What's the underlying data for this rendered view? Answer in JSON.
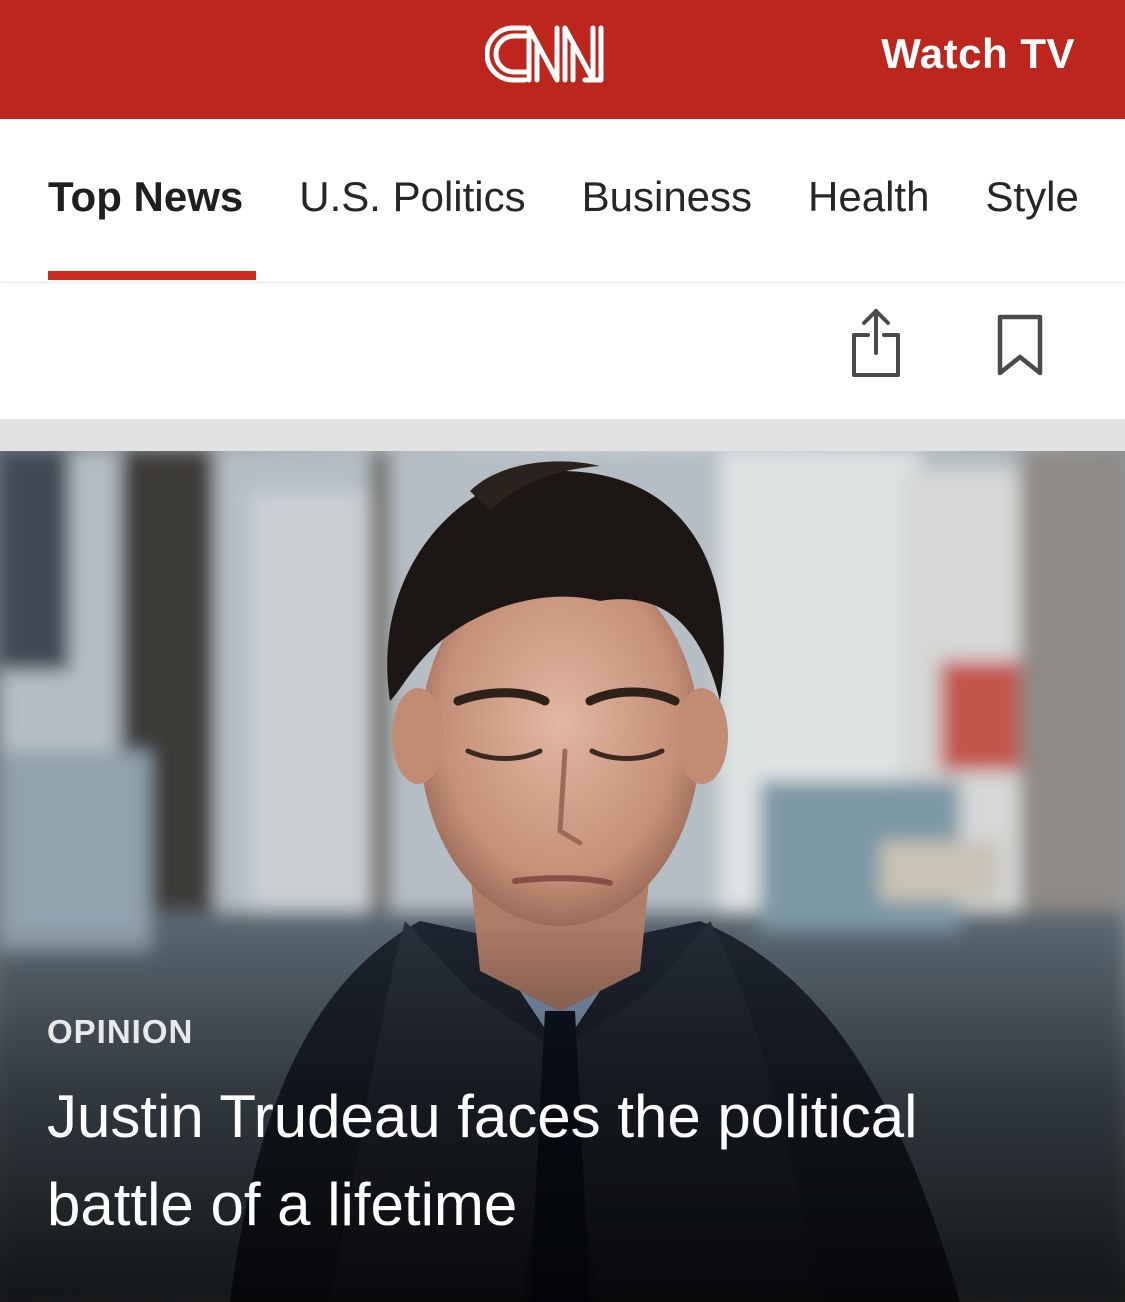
{
  "header": {
    "logo_text": "CNN",
    "watch_tv_label": "Watch TV",
    "brand_color": "#bd261c"
  },
  "nav": {
    "tabs": [
      {
        "label": "Top News",
        "active": true
      },
      {
        "label": "U.S. Politics",
        "active": false
      },
      {
        "label": "Business",
        "active": false
      },
      {
        "label": "Health",
        "active": false
      },
      {
        "label": "Style",
        "active": false
      }
    ],
    "active_underline_color": "#cc2a1f"
  },
  "actions": {
    "share_icon": "share-icon",
    "bookmark_icon": "bookmark-icon"
  },
  "hero": {
    "kicker": "OPINION",
    "headline": "Justin Trudeau faces the political battle of a lifetime"
  }
}
